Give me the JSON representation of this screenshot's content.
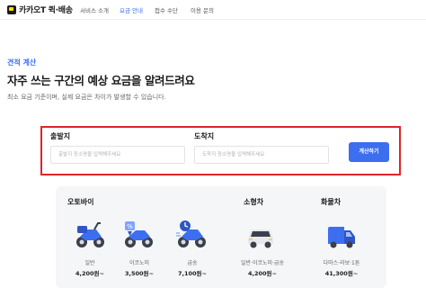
{
  "header": {
    "logo_text": "카카오T 퀵·배송",
    "nav": [
      "서비스 소개",
      "요금 안내",
      "접수 수단",
      "이용 문의"
    ]
  },
  "hero": {
    "eyebrow": "견적 계산",
    "title": "자주 쓰는 구간의 예상 요금을 알려드려요",
    "subtitle": "최소 요금 기준이며, 실제 요금은 차이가 발생할 수 있습니다."
  },
  "form": {
    "origin_label": "출발지",
    "origin_placeholder": "출발지 장소명을 입력해주세요",
    "destination_label": "도착지",
    "destination_placeholder": "도착지 장소명을 입력해주세요",
    "submit_label": "계산하기"
  },
  "vehicles": {
    "motorbike_label": "오토바이",
    "car_label": "소형차",
    "truck_label": "화물차",
    "items": [
      {
        "name": "일반",
        "price": "4,200원~"
      },
      {
        "name": "이코노미",
        "price": "3,500원~"
      },
      {
        "name": "급송",
        "price": "7,100원~"
      },
      {
        "name": "일반·이코노미·급송",
        "price": "4,200원~"
      },
      {
        "name": "다마스·라보·1톤",
        "price": "41,300원~"
      }
    ]
  },
  "colors": {
    "accent": "#3c6ff0",
    "highlight_border": "#e0242b",
    "panel_bg": "#f5f6f8"
  }
}
